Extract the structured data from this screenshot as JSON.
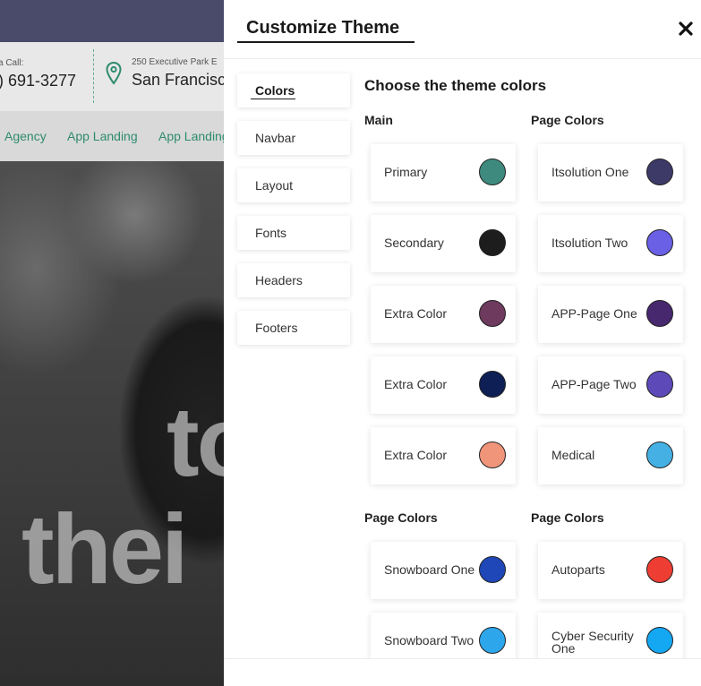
{
  "background_site": {
    "call_label": "a Call:",
    "phone": ") 691-3277",
    "address_label": "250 Executive Park E",
    "city": "San Francisco",
    "nav_links": [
      "Agency",
      "App Landing",
      "App Landing"
    ],
    "hero_line1": "to",
    "hero_line2": "thei"
  },
  "panel": {
    "title": "Customize Theme",
    "close_icon": "×",
    "tabs": [
      {
        "label": "Colors",
        "active": true
      },
      {
        "label": "Navbar",
        "active": false
      },
      {
        "label": "Layout",
        "active": false
      },
      {
        "label": "Fonts",
        "active": false
      },
      {
        "label": "Headers",
        "active": false
      },
      {
        "label": "Footers",
        "active": false
      }
    ],
    "heading": "Choose the theme colors",
    "groups": [
      {
        "title": "Main",
        "items": [
          {
            "label": "Primary",
            "color": "#3f8a7e"
          },
          {
            "label": "Secondary",
            "color": "#1d1d1d"
          },
          {
            "label": "Extra Color",
            "color": "#6e3a5e"
          },
          {
            "label": "Extra Color",
            "color": "#0e1f55"
          },
          {
            "label": "Extra Color",
            "color": "#f0957a"
          }
        ]
      },
      {
        "title": "Page Colors",
        "items": [
          {
            "label": "Itsolution One",
            "color": "#3d3a68"
          },
          {
            "label": "Itsolution Two",
            "color": "#6a60e5"
          },
          {
            "label": "APP-Page One",
            "color": "#47286f"
          },
          {
            "label": "APP-Page Two",
            "color": "#5d4ab8"
          },
          {
            "label": "Medical",
            "color": "#45b0e3"
          }
        ]
      },
      {
        "title": "Page Colors",
        "items": [
          {
            "label": "Snowboard One",
            "color": "#1f47b8"
          },
          {
            "label": "Snowboard Two",
            "color": "#2ea6ec"
          }
        ]
      },
      {
        "title": "Page Colors",
        "items": [
          {
            "label": "Autoparts",
            "color": "#ee3e33"
          },
          {
            "label": "Cyber Security One",
            "color": "#14a7f2"
          }
        ]
      }
    ]
  }
}
